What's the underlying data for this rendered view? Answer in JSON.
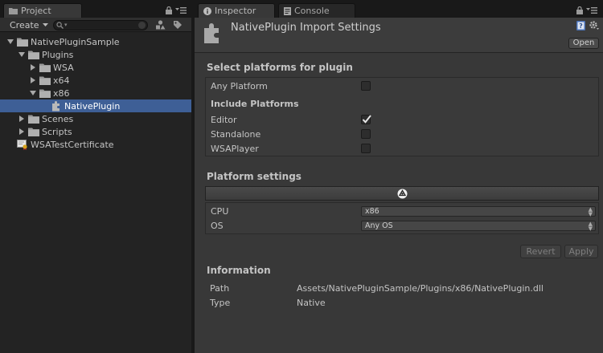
{
  "project_panel": {
    "tab_label": "Project",
    "create_label": "Create",
    "search_placeholder": "",
    "tree": [
      {
        "label": "NativePluginSample",
        "type": "folder",
        "expanded": true
      },
      {
        "label": "Plugins",
        "type": "folder",
        "expanded": true
      },
      {
        "label": "WSA",
        "type": "folder",
        "expanded": false
      },
      {
        "label": "x64",
        "type": "folder",
        "expanded": false
      },
      {
        "label": "x86",
        "type": "folder",
        "expanded": true
      },
      {
        "label": "NativePlugin",
        "type": "plugin",
        "selected": true
      },
      {
        "label": "Scenes",
        "type": "folder",
        "expanded": false
      },
      {
        "label": "Scripts",
        "type": "folder",
        "expanded": false
      },
      {
        "label": "WSATestCertificate",
        "type": "certificate"
      }
    ]
  },
  "inspector": {
    "tab_label": "Inspector",
    "console_tab_label": "Console",
    "title": "NativePlugin Import Settings",
    "open_label": "Open",
    "select_platforms_title": "Select platforms for plugin",
    "any_platform_label": "Any Platform",
    "any_platform_checked": false,
    "include_platforms_title": "Include Platforms",
    "platforms": [
      {
        "label": "Editor",
        "checked": true
      },
      {
        "label": "Standalone",
        "checked": false
      },
      {
        "label": "WSAPlayer",
        "checked": false
      }
    ],
    "platform_settings_title": "Platform settings",
    "cpu_label": "CPU",
    "cpu_value": "x86",
    "os_label": "OS",
    "os_value": "Any OS",
    "revert_label": "Revert",
    "apply_label": "Apply",
    "information_title": "Information",
    "path_label": "Path",
    "path_value": "Assets/NativePluginSample/Plugins/x86/NativePlugin.dll",
    "type_label": "Type",
    "type_value": "Native"
  },
  "colors": {
    "selection": "#3e5f96",
    "panel_bg": "#383838",
    "project_bg": "#232323"
  }
}
